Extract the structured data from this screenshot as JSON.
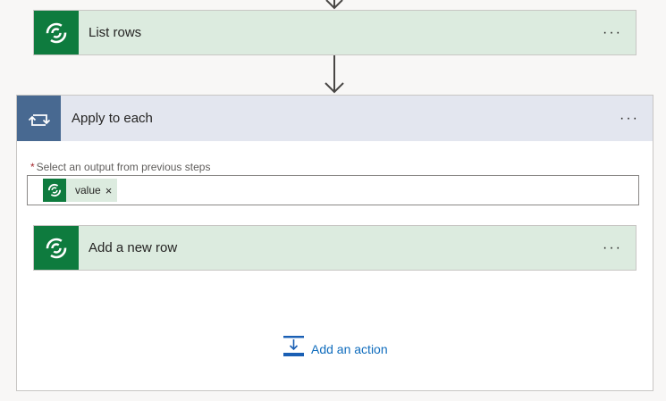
{
  "steps": {
    "list_rows": {
      "title": "List rows",
      "more": "···"
    },
    "apply_to_each": {
      "title": "Apply to each",
      "more": "···",
      "select_label": "Select an output from previous steps",
      "required_marker": "*",
      "token": {
        "label": "value",
        "remove": "×"
      },
      "inner": {
        "add_row": {
          "title": "Add a new row",
          "more": "···"
        }
      },
      "add_action": "Add an action"
    }
  },
  "colors": {
    "dataverse_green": "#0e7b3e",
    "card_green_bg": "#dcebdf",
    "loop_blue": "#486991",
    "loop_header_bg": "#e3e6ef",
    "link_blue": "#0f6cbd"
  },
  "icons": {
    "dataverse": "dataverse-icon",
    "loop": "loop-icon",
    "add_action": "add-action-icon"
  }
}
